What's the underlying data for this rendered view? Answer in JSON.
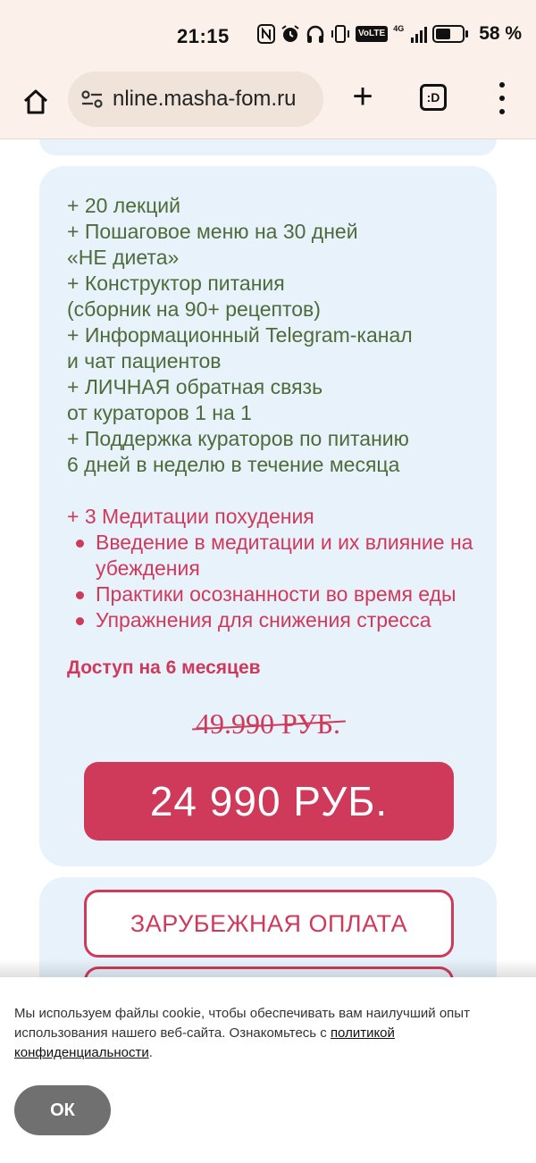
{
  "status_bar": {
    "time": "21:15",
    "icons": [
      "nfc-icon",
      "alarm-icon",
      "headphones-icon",
      "vibrate-icon",
      "volte-icon",
      "signal-icon",
      "battery-charging-icon"
    ],
    "volte_label": "VoLTE",
    "network_label": "4G",
    "battery_percent": "58 %",
    "battery_level": 0.58
  },
  "browser": {
    "url": "nline.masha-fom.ru",
    "tabs_label": ":D"
  },
  "offer": {
    "features_green": [
      "+ 20 лекций",
      "+ Пошаговое меню на 30 дней",
      "«НЕ диета»",
      "+ Конструктор питания",
      "(сборник на 90+ рецептов)",
      "+ Информационный Telegram-канал",
      "и чат пациентов",
      "+ ЛИЧНАЯ обратная связь",
      "от кураторов 1 на 1",
      "+ Поддержка кураторов по питанию",
      "6 дней в неделю в течение месяца"
    ],
    "meditation_title": "+ 3 Медитации похудения",
    "meditation_items": [
      "Введение в медитации и их влияние на убеждения",
      "Практики осознанности во время еды",
      "Упражнения для снижения стресса"
    ],
    "access": "Доступ на 6 месяцев",
    "old_price": "49.990 РУБ.",
    "price": "24 990 РУБ."
  },
  "payment": {
    "foreign_label": "ЗАРУБЕЖНАЯ ОПЛАТА"
  },
  "cookie": {
    "text": "Мы используем файлы cookie, чтобы обеспечивать вам наилучший опыт использования нашего веб-сайта. Ознакомьтесь с ",
    "link": "политикой конфиденциальности",
    "end": ".",
    "ok_label": "ОК"
  },
  "colors": {
    "accent": "#cf3a5b",
    "green_text": "#4e6b3a",
    "card_bg": "#e7f2fb",
    "browser_bg": "#fbf1ea",
    "ok_button": "#707070"
  }
}
